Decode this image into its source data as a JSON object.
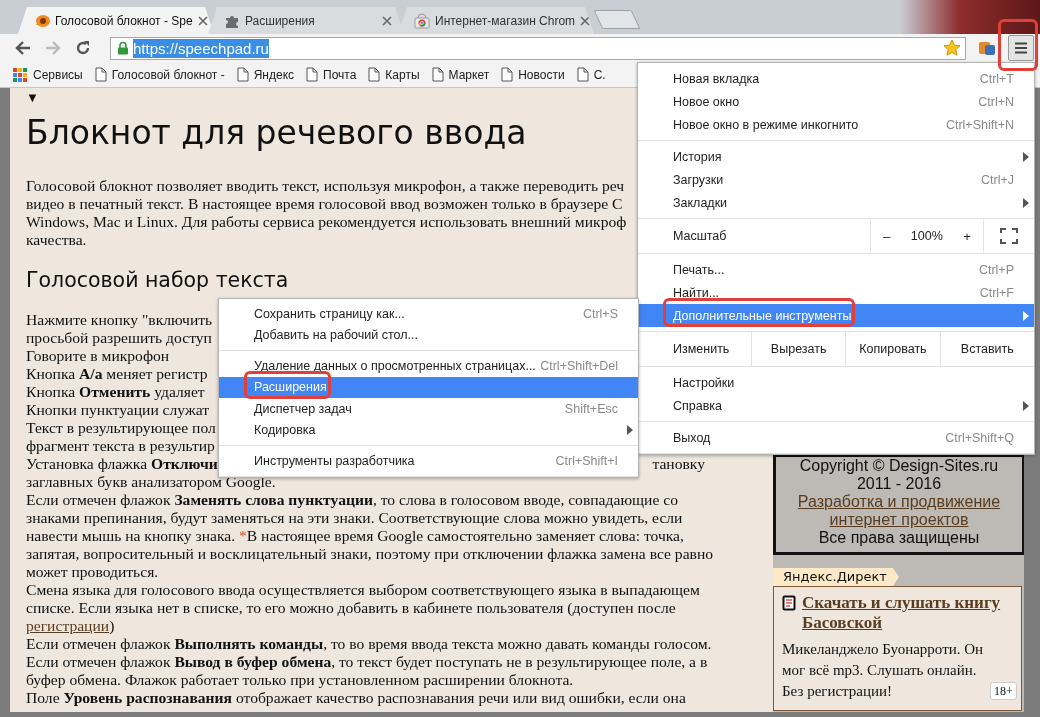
{
  "tabs": [
    {
      "title": "Голосовой блокнот - Spe",
      "selected": true
    },
    {
      "title": "Расширения",
      "selected": false
    },
    {
      "title": "Интернет-магазин Chrom",
      "selected": false
    }
  ],
  "toolbar": {
    "url": "https://speechpad.ru",
    "url_selected": true,
    "menu_annotated": true
  },
  "bookmarks": [
    {
      "label": "Сервисы",
      "kind": "apps"
    },
    {
      "label": "Голосовой блокнот -",
      "kind": "page"
    },
    {
      "label": "Яндекс",
      "kind": "page"
    },
    {
      "label": "Почта",
      "kind": "page"
    },
    {
      "label": "Карты",
      "kind": "page"
    },
    {
      "label": "Маркет",
      "kind": "page"
    },
    {
      "label": "Новости",
      "kind": "page"
    },
    {
      "label": "С.",
      "kind": "page"
    }
  ],
  "page": {
    "toggle": "▼",
    "title": "Блокнот для речевого ввода",
    "intro": [
      "Голосовой блокнот позволяет вводить текст, используя микрофон, а также переводить реч",
      "видео в печатный текст. В настоящее время голосовой ввод возможен только в браузере C",
      "Windows, Mac и Linux. Для работы сервиса рекомендуется использовать внешний микроф",
      "качества."
    ],
    "subtitle": "Голосовой набор текста",
    "lines": [
      {
        "kind": "text",
        "text": "Нажмите кнопку \"включить"
      },
      {
        "kind": "text",
        "text": "просьбой разрешить доступ"
      },
      {
        "kind": "text",
        "text": "Говорите в микрофон"
      },
      {
        "kind": "text",
        "text": "Кнопка **А/а** меняет регистр"
      },
      {
        "kind": "text",
        "text": "Кнопка **Отменить** удаляет"
      },
      {
        "kind": "text",
        "text": "Кнопки пунктуации служат"
      },
      {
        "kind": "text",
        "text": "Текст в результирующее пол"
      },
      {
        "kind": "text",
        "text": "фрагмент текста в результир"
      },
      {
        "kind": "split",
        "left": "Установка флажка **Отключи**",
        "right": "тановку"
      },
      {
        "kind": "text",
        "text": "заглавных букв анализатором Google."
      },
      {
        "kind": "text",
        "text": "Если отмечен флажок **Заменять слова пунктуации**, то слова в голосовом вводе, совпадающие со"
      },
      {
        "kind": "text",
        "text": "знаками препинания, будут заменяться на эти знаки. Соответствующие слова можно увидеть, если"
      },
      {
        "kind": "note",
        "before": "навести мышь на кнопку знака. ",
        "mark": "*",
        "after": "В настоящее время Google самостоятельно заменяет слова: точка,"
      },
      {
        "kind": "text",
        "text": "запятая, вопросительный и восклицательный знаки, поэтому при отключении флажка замена все равно"
      },
      {
        "kind": "text",
        "text": "может проводиться."
      },
      {
        "kind": "text",
        "text": "Смена языка для голосового ввода осуществляется выбором соответствующего языка в выпадающем"
      },
      {
        "kind": "text",
        "text": "списке. Если языка нет в списке, то его можно добавить в кабинете пользователя (доступен после"
      },
      {
        "kind": "link",
        "link": "регистрации",
        "after": ")"
      },
      {
        "kind": "text",
        "text": "Если отмечен флажок **Выполнять команды**, то во время ввода текста можно давать команды голосом."
      },
      {
        "kind": "text",
        "text": "Если отмечен флажок **Вывод в буфер обмена**, то текст будет поступать не в результирующее поле, а в"
      },
      {
        "kind": "text",
        "text": "буфер обмена. Флажок работает только при установленном расширении блокнота."
      },
      {
        "kind": "text",
        "text": "Поле **Уровень распознавания** отображает качество распознавания речи или вид ошибки, если она"
      }
    ]
  },
  "sidebar": {
    "copyright": [
      "Copyright © Design-Sites.ru",
      "2011 - 2016"
    ],
    "link": "Разработка и продвижение интернет проектов",
    "rights": "Все права защищены",
    "ad_label": "Яндекс.Директ",
    "ad": {
      "title": "Скачать и слушать книгу Басовской",
      "text": "Микеланджело Буонарроти. Он мог всё mp3. Слушать онлайн. Без регистрации!",
      "age": "18+"
    }
  },
  "menu": {
    "groups": [
      [
        {
          "kind": "item",
          "label": "Новая вкладка",
          "shortcut": "Ctrl+T",
          "has_submenu": false,
          "selected": false,
          "annotated": false
        },
        {
          "kind": "item",
          "label": "Новое окно",
          "shortcut": "Ctrl+N",
          "has_submenu": false,
          "selected": false,
          "annotated": false
        },
        {
          "kind": "item",
          "label": "Новое окно в режиме инкогнито",
          "shortcut": "Ctrl+Shift+N",
          "has_submenu": false,
          "selected": false,
          "annotated": false
        }
      ],
      [
        {
          "kind": "item",
          "label": "История",
          "has_submenu": true,
          "selected": false,
          "annotated": false
        },
        {
          "kind": "item",
          "label": "Загрузки",
          "shortcut": "Ctrl+J",
          "has_submenu": false,
          "selected": false,
          "annotated": false
        },
        {
          "kind": "item",
          "label": "Закладки",
          "has_submenu": true,
          "selected": false,
          "annotated": false
        }
      ],
      [
        {
          "kind": "zoom",
          "label": "Масштаб",
          "minus": "–",
          "value": "100%",
          "plus": "+"
        }
      ],
      [
        {
          "kind": "item",
          "label": "Печать...",
          "shortcut": "Ctrl+P",
          "has_submenu": false,
          "selected": false,
          "annotated": false
        },
        {
          "kind": "item",
          "label": "Найти...",
          "shortcut": "Ctrl+F",
          "has_submenu": false,
          "selected": false,
          "annotated": false
        },
        {
          "kind": "item",
          "label": "Дополнительные инструменты",
          "has_submenu": true,
          "selected": true,
          "annotated": true
        }
      ],
      [
        {
          "kind": "edit",
          "label": "Изменить",
          "buttons": [
            "Вырезать",
            "Копировать",
            "Вставить"
          ]
        }
      ],
      [
        {
          "kind": "item",
          "label": "Настройки",
          "has_submenu": false,
          "selected": false,
          "annotated": false
        },
        {
          "kind": "item",
          "label": "Справка",
          "has_submenu": true,
          "selected": false,
          "annotated": false
        }
      ],
      [
        {
          "kind": "item",
          "label": "Выход",
          "shortcut": "Ctrl+Shift+Q",
          "has_submenu": false,
          "selected": false,
          "annotated": false
        }
      ]
    ]
  },
  "submenu": {
    "groups": [
      [
        {
          "kind": "item",
          "label": "Сохранить страницу как...",
          "shortcut": "Ctrl+S",
          "has_submenu": false,
          "selected": false,
          "annotated": false
        },
        {
          "kind": "item",
          "label": "Добавить на рабочий стол...",
          "has_submenu": false,
          "selected": false,
          "annotated": false
        }
      ],
      [
        {
          "kind": "item",
          "label": "Удаление данных о просмотренных страницах...",
          "shortcut": "Ctrl+Shift+Del",
          "has_submenu": false,
          "selected": false,
          "annotated": false
        },
        {
          "kind": "item",
          "label": "Расширения",
          "has_submenu": false,
          "selected": true,
          "annotated": true
        },
        {
          "kind": "item",
          "label": "Диспетчер задач",
          "shortcut": "Shift+Esc",
          "has_submenu": false,
          "selected": false,
          "annotated": false
        },
        {
          "kind": "item",
          "label": "Кодировка",
          "has_submenu": true,
          "selected": false,
          "annotated": false
        }
      ],
      [
        {
          "kind": "item",
          "label": "Инструменты разработчика",
          "shortcut": "Ctrl+Shift+I",
          "has_submenu": false,
          "selected": false,
          "annotated": false
        }
      ]
    ]
  }
}
